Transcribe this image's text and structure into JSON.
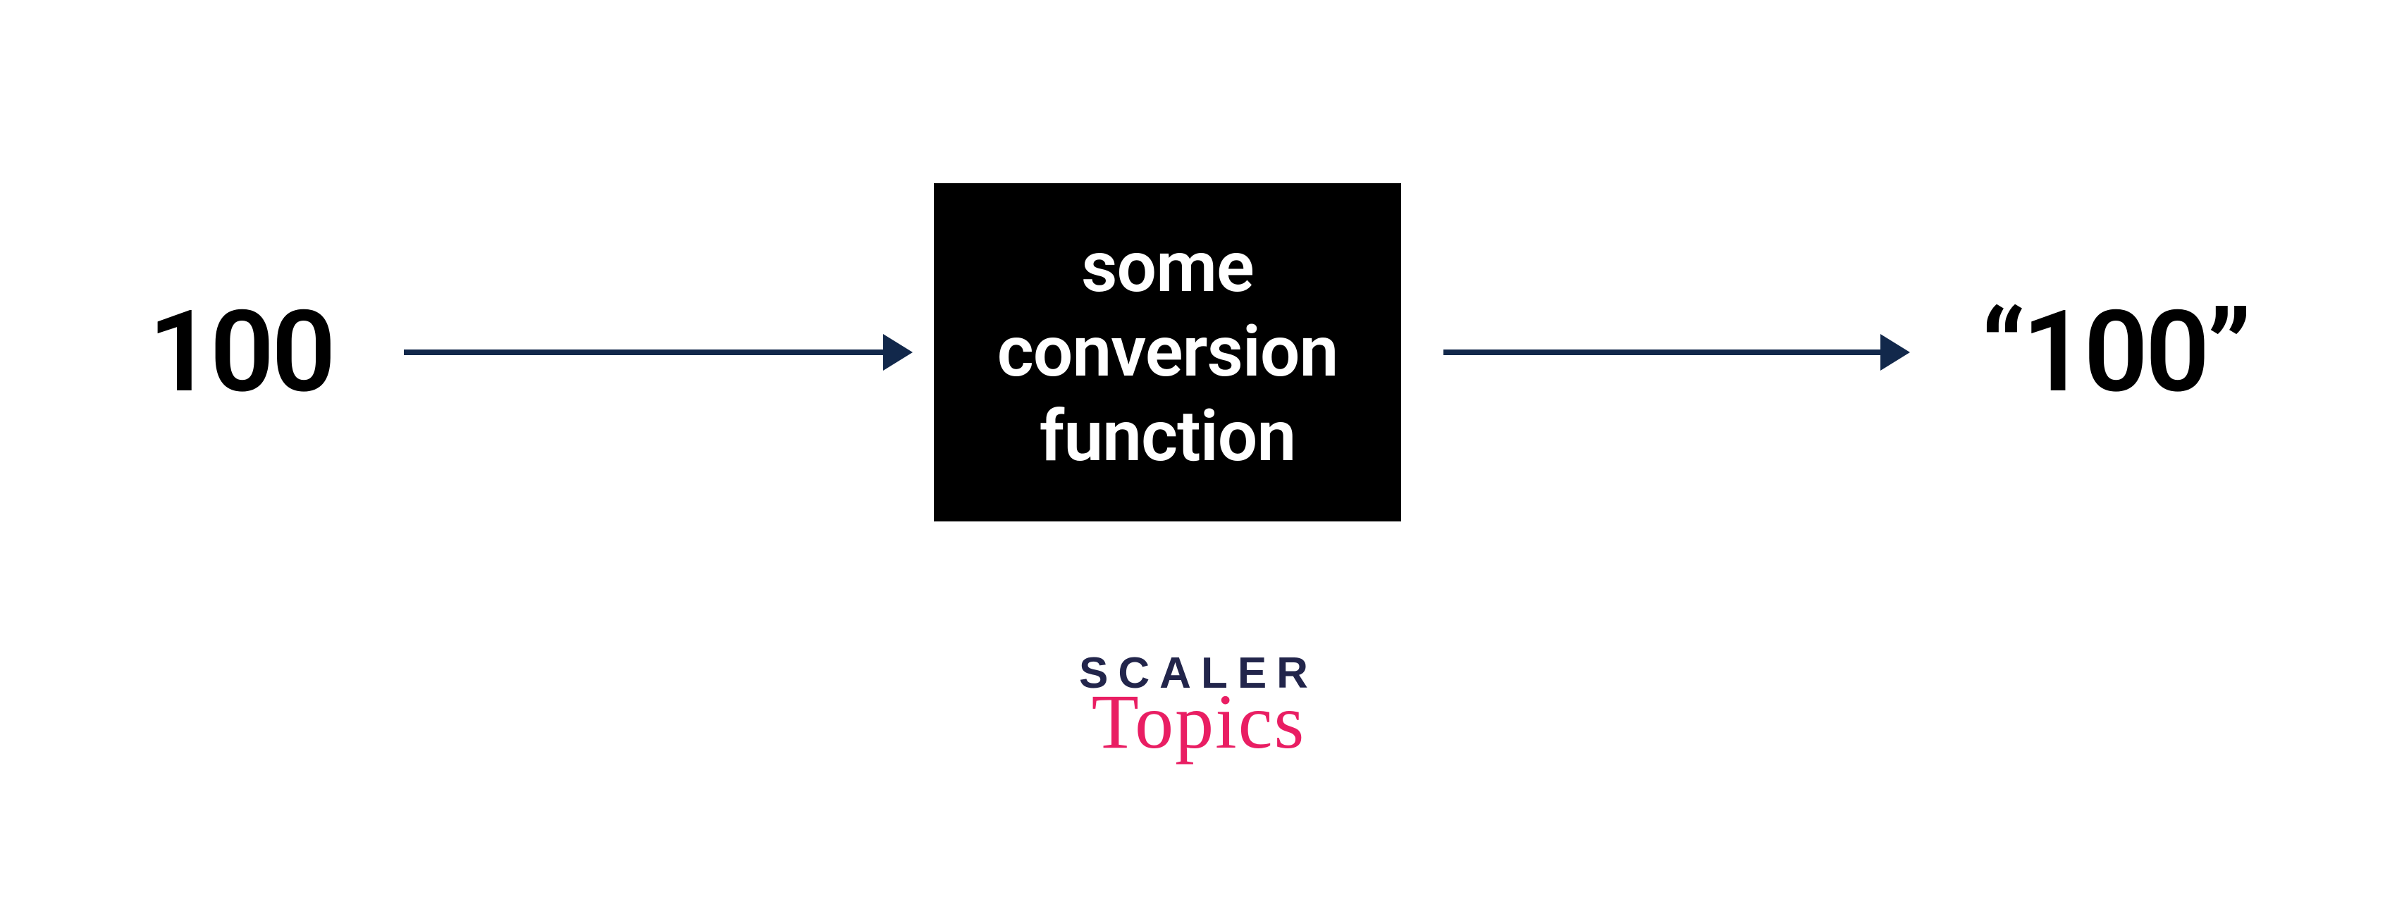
{
  "diagram": {
    "input": "100",
    "box_line1": "some",
    "box_line2": "conversion",
    "box_line3": "function",
    "output": "“100”"
  },
  "brand": {
    "name": "SCALER",
    "sub": "Topics"
  }
}
